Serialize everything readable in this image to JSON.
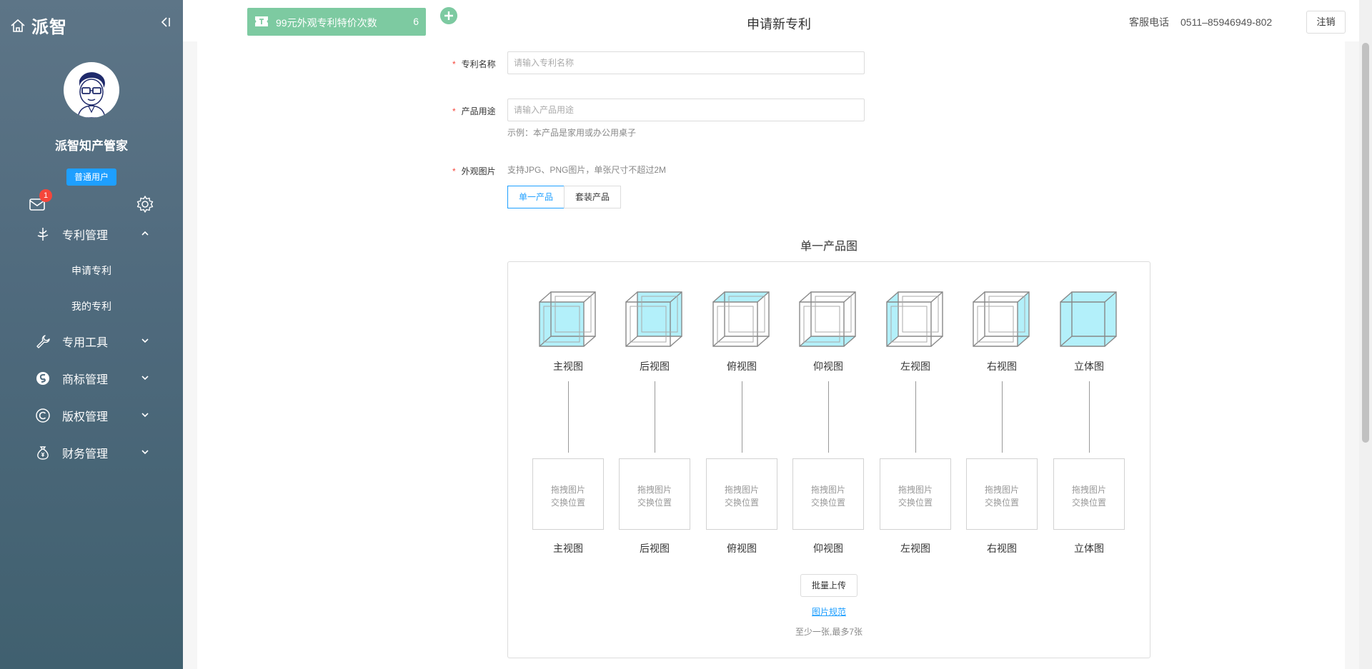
{
  "sidebar": {
    "brand": "派智",
    "user_name": "派智知产管家",
    "user_role": "普通用户",
    "unread_count": "1",
    "nav": [
      {
        "label": "专利管理",
        "expanded": true,
        "children": [
          "申请专利",
          "我的专利"
        ]
      },
      {
        "label": "专用工具",
        "expanded": false
      },
      {
        "label": "商标管理",
        "expanded": false
      },
      {
        "label": "版权管理",
        "expanded": false
      },
      {
        "label": "财务管理",
        "expanded": false
      }
    ]
  },
  "header": {
    "promo_label": "99元外观专利特价次数",
    "promo_count": "6",
    "title": "申请新专利",
    "service_label": "客服电话",
    "service_phone": "0511–85946949-802",
    "logout": "注销"
  },
  "form": {
    "patent_name": {
      "label": "专利名称",
      "placeholder": "请输入专利名称",
      "value": ""
    },
    "product_use": {
      "label": "产品用途",
      "placeholder": "请输入产品用途",
      "value": "",
      "example": "示例：本产品是家用或办公用桌子"
    },
    "images": {
      "label": "外观图片",
      "hint": "支持JPG、PNG图片，单张尺寸不超过2M",
      "tabs": [
        "单一产品",
        "套装产品"
      ],
      "active_tab": "单一产品",
      "section_title": "单一产品图",
      "views": [
        "主视图",
        "后视图",
        "俯视图",
        "仰视图",
        "左视图",
        "右视图",
        "立体图"
      ],
      "drop_text_1": "拖拽图片",
      "drop_text_2": "交换位置",
      "batch_upload": "批量上传",
      "spec_link": "图片规范",
      "limit_note": "至少一张,最多7张"
    }
  },
  "colors": {
    "accent": "#1e9fff",
    "promo": "#7dcaa1",
    "highlight": "#b3f0fa",
    "badge": "#f5463b"
  }
}
